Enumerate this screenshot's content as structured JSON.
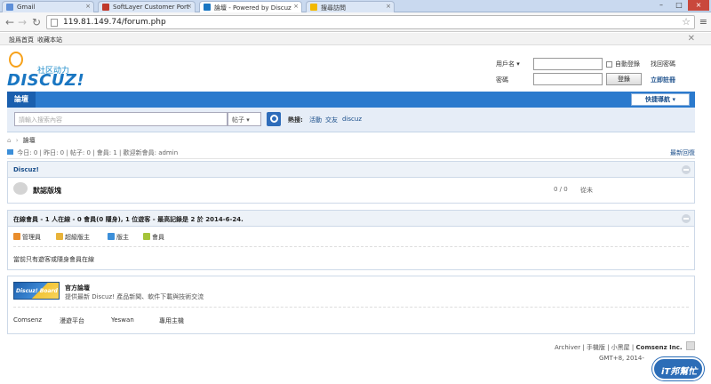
{
  "browser": {
    "tabs": [
      {
        "label": "Gmail",
        "active": false,
        "favicon_color": "#5e8fd8"
      },
      {
        "label": "SoftLayer Customer Port",
        "active": false,
        "favicon_color": "#c0392b"
      },
      {
        "label": "論壇 - Powered by Discuz",
        "active": true,
        "favicon_color": "#1976c2"
      },
      {
        "label": "搜尋訪問",
        "active": false,
        "favicon_color": "#f2b900"
      }
    ],
    "url": "119.81.149.74/forum.php",
    "back_icon": "←",
    "forward_icon": "→",
    "reload_icon": "↻",
    "star_icon": "☆",
    "menu_icon": "≡",
    "close_tab": "×",
    "window_controls": [
      "–",
      "□",
      "×"
    ]
  },
  "topbar": {
    "set_home": "設爲首頁",
    "bookmark": "收藏本站",
    "close": "✕"
  },
  "logo": {
    "tagline": "社区动力",
    "wordmark": "DISCUZ!"
  },
  "login": {
    "username_label": "用戶名",
    "password_label": "密碼",
    "auto_login": "自動登錄",
    "forgot": "找回密碼",
    "login_button": "登錄",
    "register": "立即註冊"
  },
  "nav": {
    "current": "論壇",
    "quick_nav": "快捷導航 ▾"
  },
  "search": {
    "placeholder": "請輸入搜索內容",
    "scope": "帖子 ▾",
    "hot_label": "熱搜:",
    "hot_terms": [
      "活動",
      "交友",
      "discuz"
    ]
  },
  "breadcrumb": {
    "home_icon": "⌂",
    "sep": "›",
    "current": "論壇"
  },
  "stats": {
    "text": "今日: 0 | 昨日: 0 | 帖子: 0 | 會員: 1 | 歡迎新會員: admin",
    "latest": "最新回復"
  },
  "category": {
    "title": "Discuz!",
    "forum_name": "默認版塊",
    "counts": "0 / 0",
    "last_post": "從未"
  },
  "online": {
    "title": "在線會員 - 1 人在線 - 0 會員(0 隱身), 1 位遊客 - 最高記錄是 2 於 2014-6-24.",
    "legend": [
      {
        "label": "管理員",
        "color": "#e98d2c"
      },
      {
        "label": "超級版主",
        "color": "#e8b33a"
      },
      {
        "label": "版主",
        "color": "#3c8fd9"
      },
      {
        "label": "會員",
        "color": "#a5c43a"
      }
    ],
    "note": "當前只有遊客或隱身會員在線"
  },
  "links": {
    "banner_text": "Discuz! Board",
    "official_title": "官方論壇",
    "official_desc": "提供最新 Discuz! 產品新聞、軟件下載與技術交流",
    "friends": [
      "Comsenz",
      "漫遊平台",
      "Yeswan",
      "專用主機"
    ]
  },
  "footer": {
    "links": "Archiver | 手機版 | 小黑屋 | ",
    "brand": "Comsenz Inc.",
    "time": "GMT+8, 2014-",
    "watermark": "iT邦幫忙"
  }
}
